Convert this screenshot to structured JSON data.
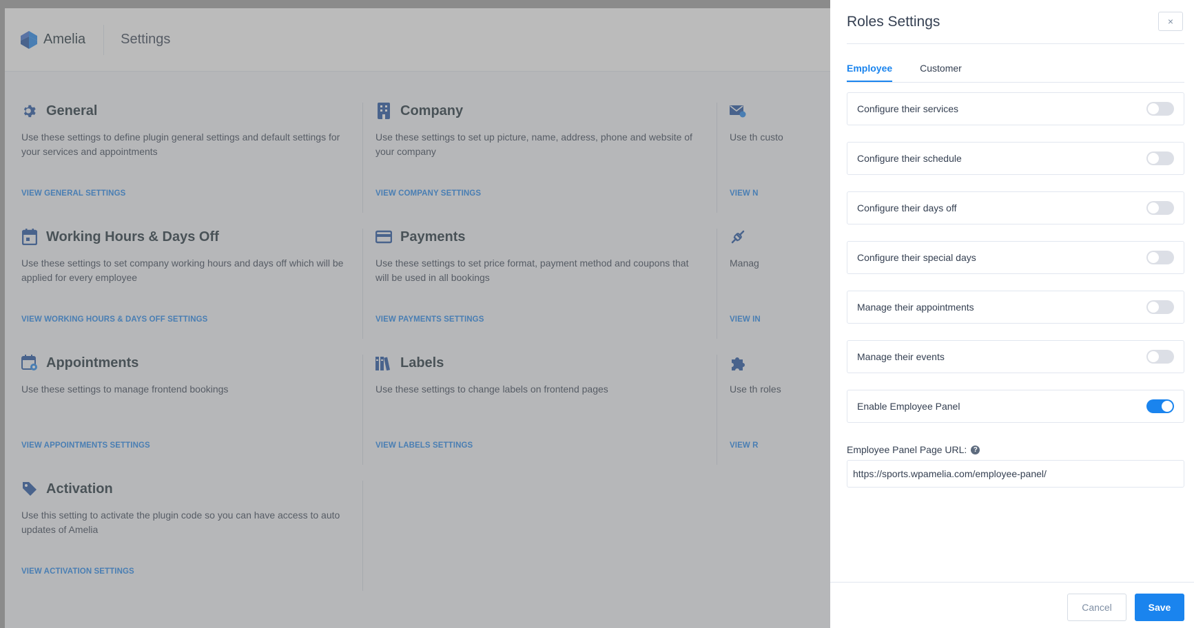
{
  "app": {
    "brand": "Amelia",
    "page_title": "Settings"
  },
  "cards": [
    {
      "title": "General",
      "desc": "Use these settings to define plugin general settings and default settings for your services and appointments",
      "link": "VIEW GENERAL SETTINGS",
      "icon": "gear-icon"
    },
    {
      "title": "Company",
      "desc": "Use these settings to set up picture, name, address, phone and website of your company",
      "link": "VIEW COMPANY SETTINGS",
      "icon": "building-icon"
    },
    {
      "title": "",
      "desc": "Use th custo",
      "link": "VIEW N",
      "icon": "mail-icon"
    },
    {
      "title": "Working Hours & Days Off",
      "desc": "Use these settings to set company working hours and days off which will be applied for every employee",
      "link": "VIEW WORKING HOURS & DAYS OFF SETTINGS",
      "icon": "calendar-icon"
    },
    {
      "title": "Payments",
      "desc": "Use these settings to set price format, payment method and coupons that will be used in all bookings",
      "link": "VIEW PAYMENTS SETTINGS",
      "icon": "credit-card-icon"
    },
    {
      "title": "",
      "desc": "Manag",
      "link": "VIEW IN",
      "icon": "plug-icon"
    },
    {
      "title": "Appointments",
      "desc": "Use these settings to manage frontend bookings",
      "link": "VIEW APPOINTMENTS SETTINGS",
      "icon": "calendar-gear-icon"
    },
    {
      "title": "Labels",
      "desc": "Use these settings to change labels on frontend pages",
      "link": "VIEW LABELS SETTINGS",
      "icon": "books-icon"
    },
    {
      "title": "",
      "desc": "Use th roles",
      "link": "VIEW R",
      "icon": "puzzle-icon"
    },
    {
      "title": "Activation",
      "desc": "Use this setting to activate the plugin code so you can have access to auto updates of Amelia",
      "link": "VIEW ACTIVATION SETTINGS",
      "icon": "tag-icon"
    }
  ],
  "dialog": {
    "title": "Roles Settings",
    "close": "×",
    "tabs": [
      "Employee",
      "Customer"
    ],
    "options": [
      {
        "label": "Configure their services",
        "enabled": false
      },
      {
        "label": "Configure their schedule",
        "enabled": false
      },
      {
        "label": "Configure their days off",
        "enabled": false
      },
      {
        "label": "Configure their special days",
        "enabled": false
      },
      {
        "label": "Manage their appointments",
        "enabled": false
      },
      {
        "label": "Manage their events",
        "enabled": false
      },
      {
        "label": "Enable Employee Panel",
        "enabled": true
      }
    ],
    "url_label": "Employee Panel Page URL:",
    "url_value": "https://sports.wpamelia.com/employee-panel/",
    "cancel": "Cancel",
    "save": "Save"
  },
  "colors": {
    "accent": "#1a84ee",
    "icon": "#1a4fa0",
    "text": "#354052"
  }
}
